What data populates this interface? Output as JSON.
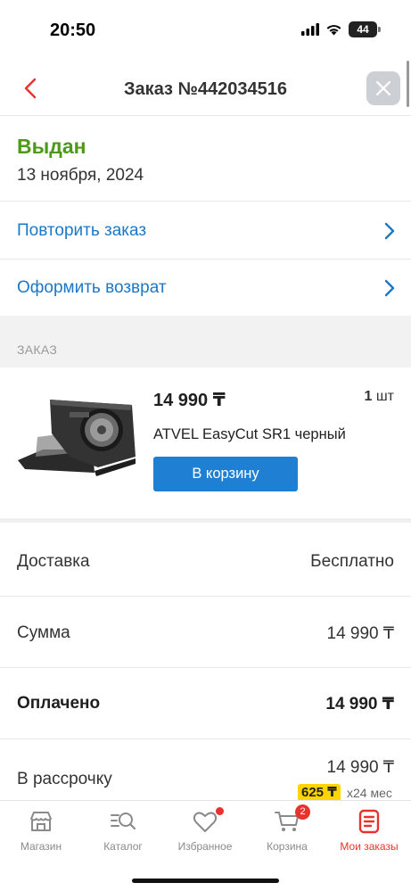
{
  "status_bar": {
    "time": "20:50",
    "battery": "44"
  },
  "header": {
    "title": "Заказ №442034516",
    "back_icon": "chevron-left-icon",
    "close_icon": "close-icon"
  },
  "order": {
    "status": "Выдан",
    "status_color": "#4c9a17",
    "date": "13 ноября, 2024"
  },
  "actions": [
    {
      "label": "Повторить заказ"
    },
    {
      "label": "Оформить возврат"
    }
  ],
  "section": {
    "label": "ЗАКАЗ"
  },
  "product": {
    "price": "14 990 ₸",
    "qty_value": "1",
    "qty_unit": "шт",
    "name": "ATVEL EasyCut SR1 черный",
    "cart_button": "В корзину"
  },
  "summary": [
    {
      "label": "Доставка",
      "value": "Бесплатно"
    },
    {
      "label": "Сумма",
      "value": "14 990 ₸"
    },
    {
      "label": "Оплачено",
      "value": "14 990 ₸"
    },
    {
      "label": "В рассрочку",
      "value": "14 990 ₸"
    }
  ],
  "installment": {
    "monthly": "625 ₸",
    "months": "x24 мес"
  },
  "tabs": [
    {
      "label": "Магазин",
      "icon": "store-icon"
    },
    {
      "label": "Каталог",
      "icon": "catalog-search-icon"
    },
    {
      "label": "Избранное",
      "icon": "heart-icon"
    },
    {
      "label": "Корзина",
      "icon": "cart-icon",
      "badge": "2"
    },
    {
      "label": "Мои заказы",
      "icon": "orders-icon"
    }
  ],
  "colors": {
    "accent": "#e8322d",
    "link": "#1b78c7",
    "button": "#1f7fd2",
    "installment_badge": "#ffd400"
  }
}
